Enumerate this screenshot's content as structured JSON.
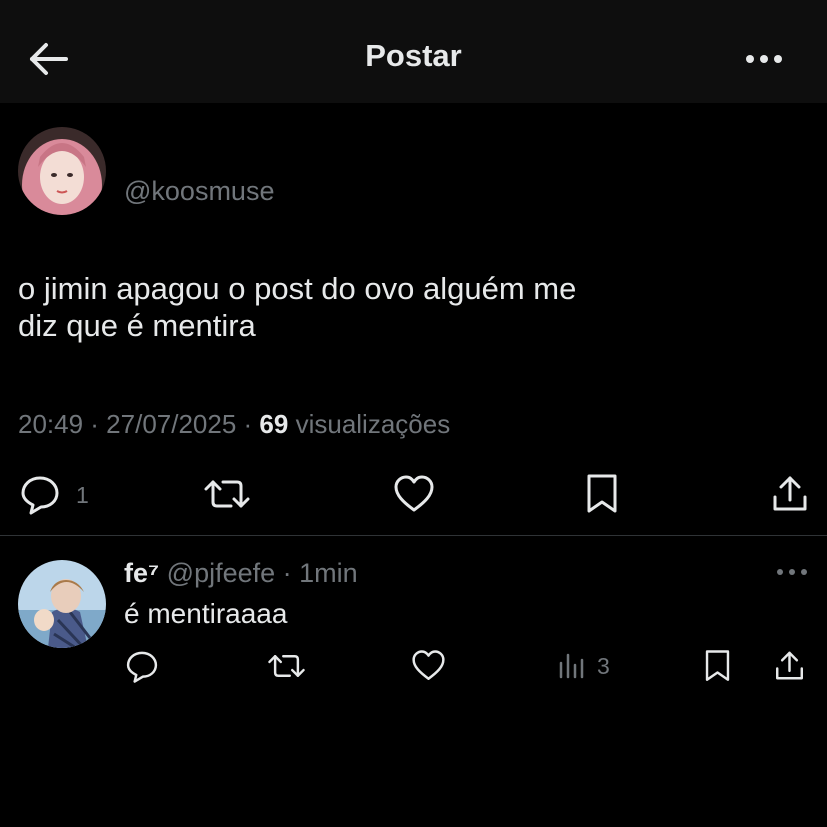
{
  "header": {
    "title": "Postar"
  },
  "post": {
    "handle": "@koosmuse",
    "text_line1": "o jimin apagou o post do ovo alguém me",
    "text_line2": "diz que é mentira",
    "time": "20:49 · 27/07/2025 ·",
    "views": "69",
    "views_label": "visualizações",
    "reply_count": "1"
  },
  "reply": {
    "name": "fe⁷",
    "handle": "@pjfeefe",
    "time": "· 1min",
    "text": "é mentiraaaa",
    "view_count": "3"
  },
  "icons": {
    "back": "arrow-left-icon",
    "more": "more-horizontal-icon",
    "reply": "comment-icon",
    "retweet": "repost-icon",
    "like": "heart-icon",
    "bookmark": "bookmark-icon",
    "share": "share-icon",
    "views": "bar-chart-icon"
  },
  "colors": {
    "background": "#000000",
    "text": "#e7e9ea",
    "muted": "#71767b",
    "header": "#0e0e0e"
  }
}
